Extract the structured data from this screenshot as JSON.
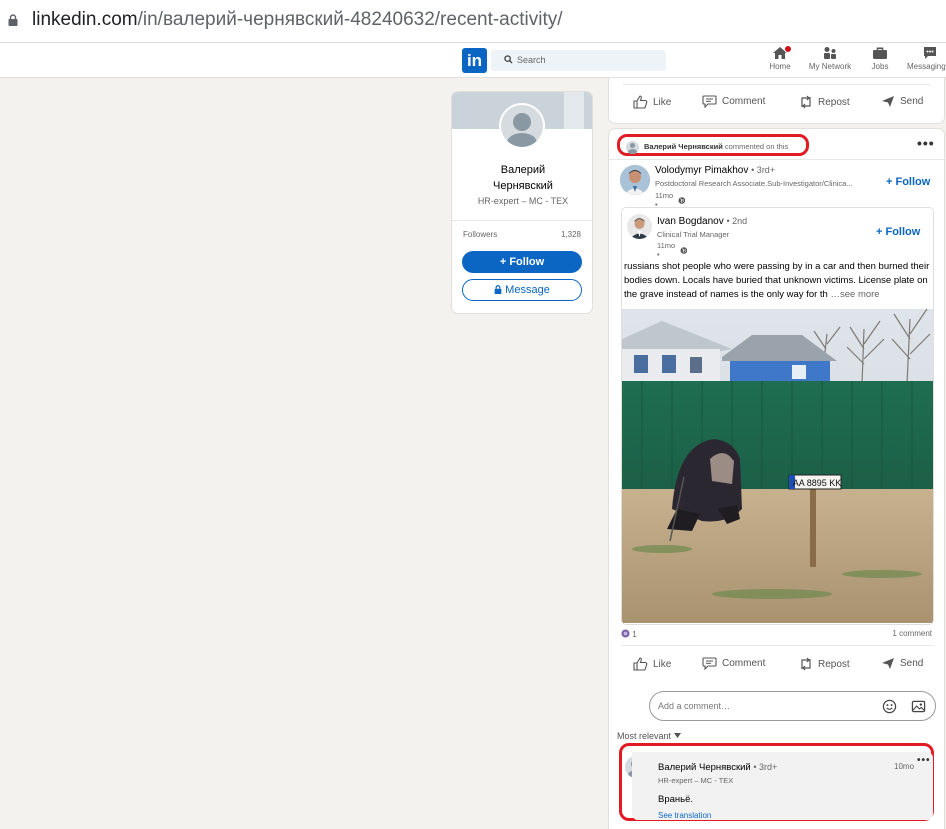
{
  "browser": {
    "url_host": "linkedin.com",
    "url_path": "/in/валерий-чернявский-48240632/recent-activity/"
  },
  "nav": {
    "logo_text": "in",
    "search_placeholder": "Search",
    "items": [
      {
        "label": "Home"
      },
      {
        "label": "My Network"
      },
      {
        "label": "Jobs"
      },
      {
        "label": "Messaging"
      }
    ]
  },
  "profile": {
    "name_line1": "Валерий",
    "name_line2": "Чернявский",
    "headline": "HR-expert – MC - TEX",
    "followers_label": "Followers",
    "followers_count": "1,328",
    "follow_label": "+ Follow",
    "message_label": "Message"
  },
  "actions": {
    "like": "Like",
    "comment": "Comment",
    "repost": "Repost",
    "send": "Send"
  },
  "activity": {
    "actor": "Валерий Чернявский",
    "verb": "commented on this",
    "menu": "•••"
  },
  "outer_author": {
    "name": "Volodymyr Pimakhov",
    "degree": "• 3rd+",
    "subtitle": "Postdoctoral Research Associate.Sub-Investigator/Clinica...",
    "time": "11mo •",
    "follow": "+ Follow"
  },
  "inner_author": {
    "name": "Ivan Bogdanov",
    "degree": "• 2nd",
    "subtitle": "Clinical Trial Manager",
    "time": "11mo •",
    "follow": "+ Follow"
  },
  "post": {
    "text": "russians shot people who were passing by in a car and then burned their bodies down. Locals have buried that unknown victims. License plate on the grave instead of names is the only way for th",
    "see_more": "…see more",
    "plate": "AA 8895 KK",
    "reactions_count": "1",
    "comments_count": "1 comment"
  },
  "comment_input": {
    "placeholder": "Add a comment…"
  },
  "sort_label": "Most relevant",
  "comment": {
    "name": "Валерий Чернявский",
    "degree": "• 3rd+",
    "subtitle": "HR-expert – MC - TEX",
    "time": "10mo",
    "menu": "•••",
    "text": "Враньё.",
    "translation": "See translation"
  },
  "colors": {
    "brand": "#0a66c2",
    "highlight": "#e01b24",
    "background": "#f3f2ef"
  }
}
